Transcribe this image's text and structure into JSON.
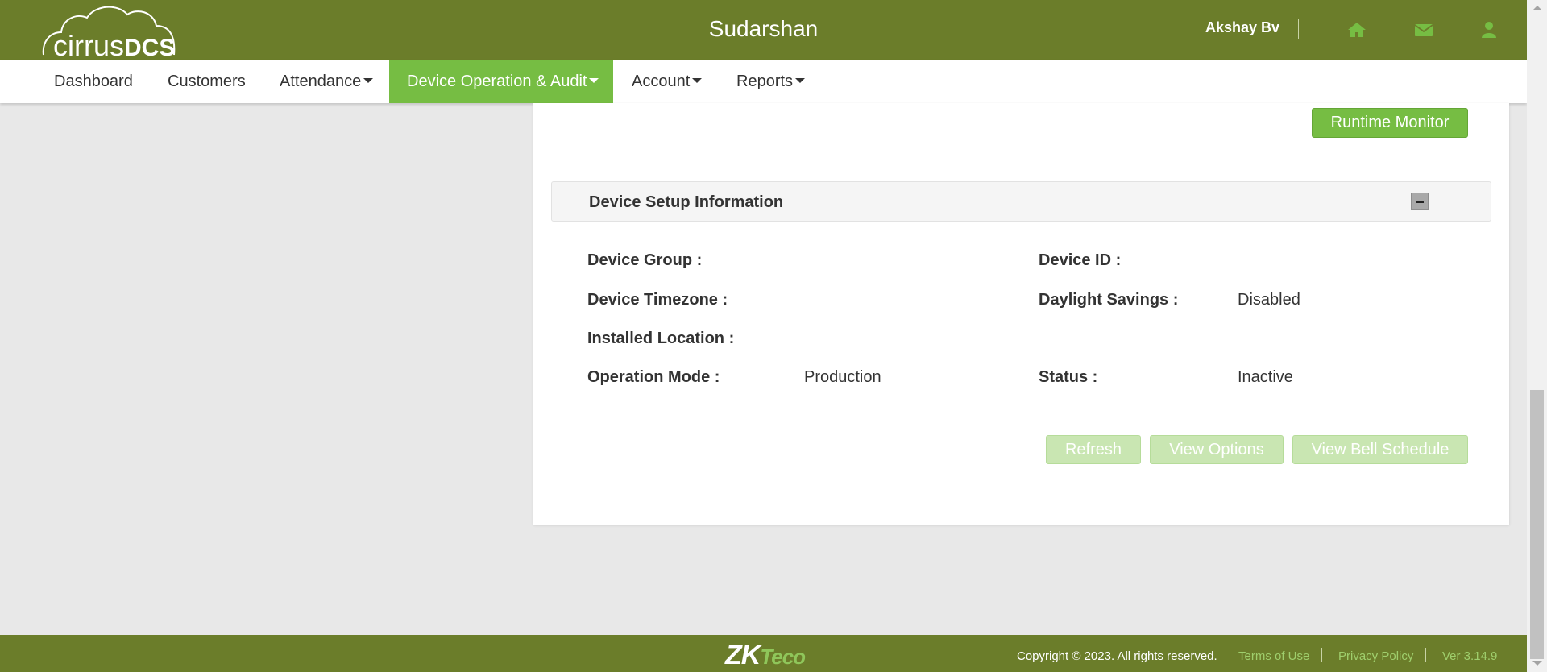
{
  "header": {
    "logo_text_thin": "cirrus",
    "logo_text_bold": "DCS",
    "title": "Sudarshan",
    "user_name": "Akshay Bv",
    "icons": [
      "home-icon",
      "envelope-icon",
      "user-icon"
    ]
  },
  "nav": {
    "items": [
      {
        "label": "Dashboard",
        "dropdown": false
      },
      {
        "label": "Customers",
        "dropdown": false
      },
      {
        "label": "Attendance",
        "dropdown": true
      },
      {
        "label": "Device Operation & Audit",
        "dropdown": true,
        "active": true
      },
      {
        "label": "Account",
        "dropdown": true
      },
      {
        "label": "Reports",
        "dropdown": true
      }
    ]
  },
  "main": {
    "runtime_monitor_label": "Runtime Monitor",
    "panel": {
      "title": "Device Setup Information",
      "fields": {
        "device_group": {
          "label": "Device Group :",
          "value": ""
        },
        "device_id": {
          "label": "Device ID :",
          "value": ""
        },
        "device_timezone": {
          "label": "Device Timezone :",
          "value": ""
        },
        "daylight_savings": {
          "label": "Daylight Savings :",
          "value": "Disabled"
        },
        "installed_location": {
          "label": "Installed Location :",
          "value": ""
        },
        "operation_mode": {
          "label": "Operation Mode :",
          "value": "Production"
        },
        "status": {
          "label": "Status :",
          "value": "Inactive"
        }
      },
      "buttons": {
        "refresh": "Refresh",
        "view_options": "View Options",
        "view_bell_schedule": "View Bell Schedule"
      }
    }
  },
  "footer": {
    "logo_zk": "ZK",
    "logo_teco": "Teco",
    "copyright": "Copyright © 2023. All rights reserved.",
    "terms": "Terms of Use",
    "privacy": "Privacy Policy",
    "version": "Ver 3.14.9"
  },
  "colors": {
    "header_bg": "#6b7d2a",
    "accent_green": "#76bd43",
    "disabled_green": "#c9e6b2",
    "footer_link": "#9fcf6d"
  }
}
